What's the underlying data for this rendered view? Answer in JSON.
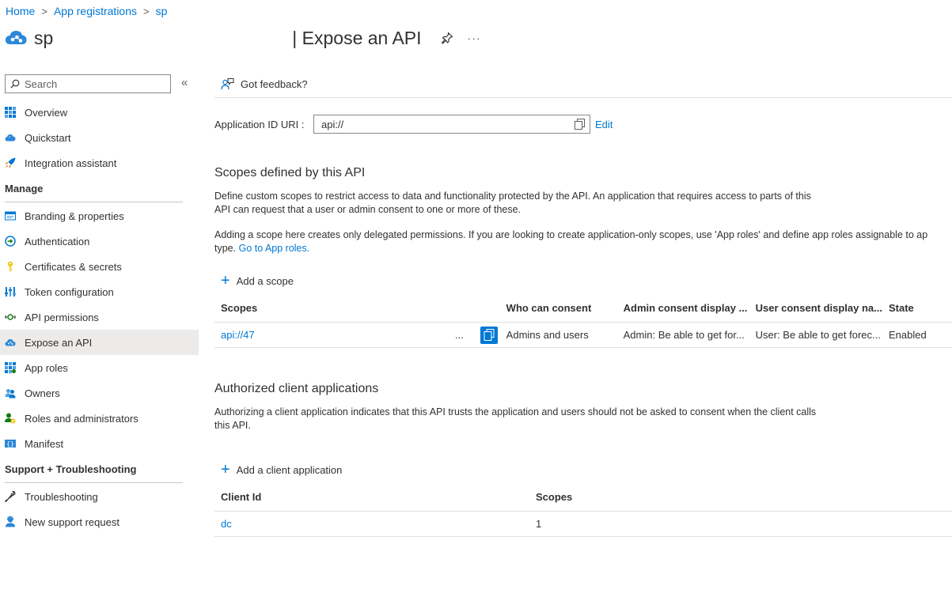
{
  "breadcrumb": {
    "home": "Home",
    "app_registrations": "App registrations",
    "current": "sp"
  },
  "header": {
    "title_prefix": "sp",
    "title_suffix": "| Expose an API",
    "more": "···"
  },
  "sidebar": {
    "search_placeholder": "Search",
    "collapse": "«",
    "items_top": [
      {
        "label": "Overview",
        "icon": "overview-grid-icon"
      },
      {
        "label": "Quickstart",
        "icon": "cloud-icon"
      },
      {
        "label": "Integration assistant",
        "icon": "rocket-icon"
      }
    ],
    "section_manage": "Manage",
    "items_manage": [
      {
        "label": "Branding & properties",
        "icon": "branding-icon"
      },
      {
        "label": "Authentication",
        "icon": "authentication-icon"
      },
      {
        "label": "Certificates & secrets",
        "icon": "key-icon"
      },
      {
        "label": "Token configuration",
        "icon": "token-bars-icon"
      },
      {
        "label": "API permissions",
        "icon": "api-permissions-icon"
      },
      {
        "label": "Expose an API",
        "icon": "cloud-api-icon",
        "active": true
      },
      {
        "label": "App roles",
        "icon": "app-roles-grid-icon"
      },
      {
        "label": "Owners",
        "icon": "owners-icon"
      },
      {
        "label": "Roles and administrators",
        "icon": "roles-admin-icon"
      },
      {
        "label": "Manifest",
        "icon": "manifest-icon"
      }
    ],
    "section_support": "Support + Troubleshooting",
    "items_support": [
      {
        "label": "Troubleshooting",
        "icon": "wrench-icon"
      },
      {
        "label": "New support request",
        "icon": "support-person-icon"
      }
    ]
  },
  "main": {
    "feedback": "Got feedback?",
    "app_id_uri_label": "Application ID URI :",
    "app_id_uri_value": "api://",
    "edit": "Edit",
    "scopes_title": "Scopes defined by this API",
    "scopes_desc_1": "Define custom scopes to restrict access to data and functionality protected by the API. An application that requires access to parts of this",
    "scopes_desc_2": "API can request that a user or admin consent to one or more of these.",
    "scopes_note_1": "Adding a scope here creates only delegated permissions. If you are looking to create application-only scopes, use 'App roles' and define app roles assignable to ap",
    "scopes_note_2": "type.",
    "go_to_app_roles": "Go to App roles.",
    "add_scope": "Add a scope",
    "scopes_table": {
      "headers": [
        "Scopes",
        "Who can consent",
        "Admin consent display ...",
        "User consent display na...",
        "State"
      ],
      "rows": [
        {
          "scope": "api://47",
          "ellipsis": "...",
          "who": "Admins and users",
          "admin": "Admin: Be able to get for...",
          "user": "User: Be able to get forec...",
          "state": "Enabled"
        }
      ]
    },
    "auth_title": "Authorized client applications",
    "auth_desc_1": "Authorizing a client application indicates that this API trusts the application and users should not be asked to consent when the client calls",
    "auth_desc_2": "this API.",
    "add_client": "Add a client application",
    "client_table": {
      "headers": [
        "Client Id",
        "Scopes"
      ],
      "rows": [
        {
          "client_id": "dc",
          "scopes": "1"
        }
      ]
    }
  },
  "colors": {
    "accent": "#0078d4",
    "active_bg": "#edebe9",
    "text": "#323130"
  }
}
